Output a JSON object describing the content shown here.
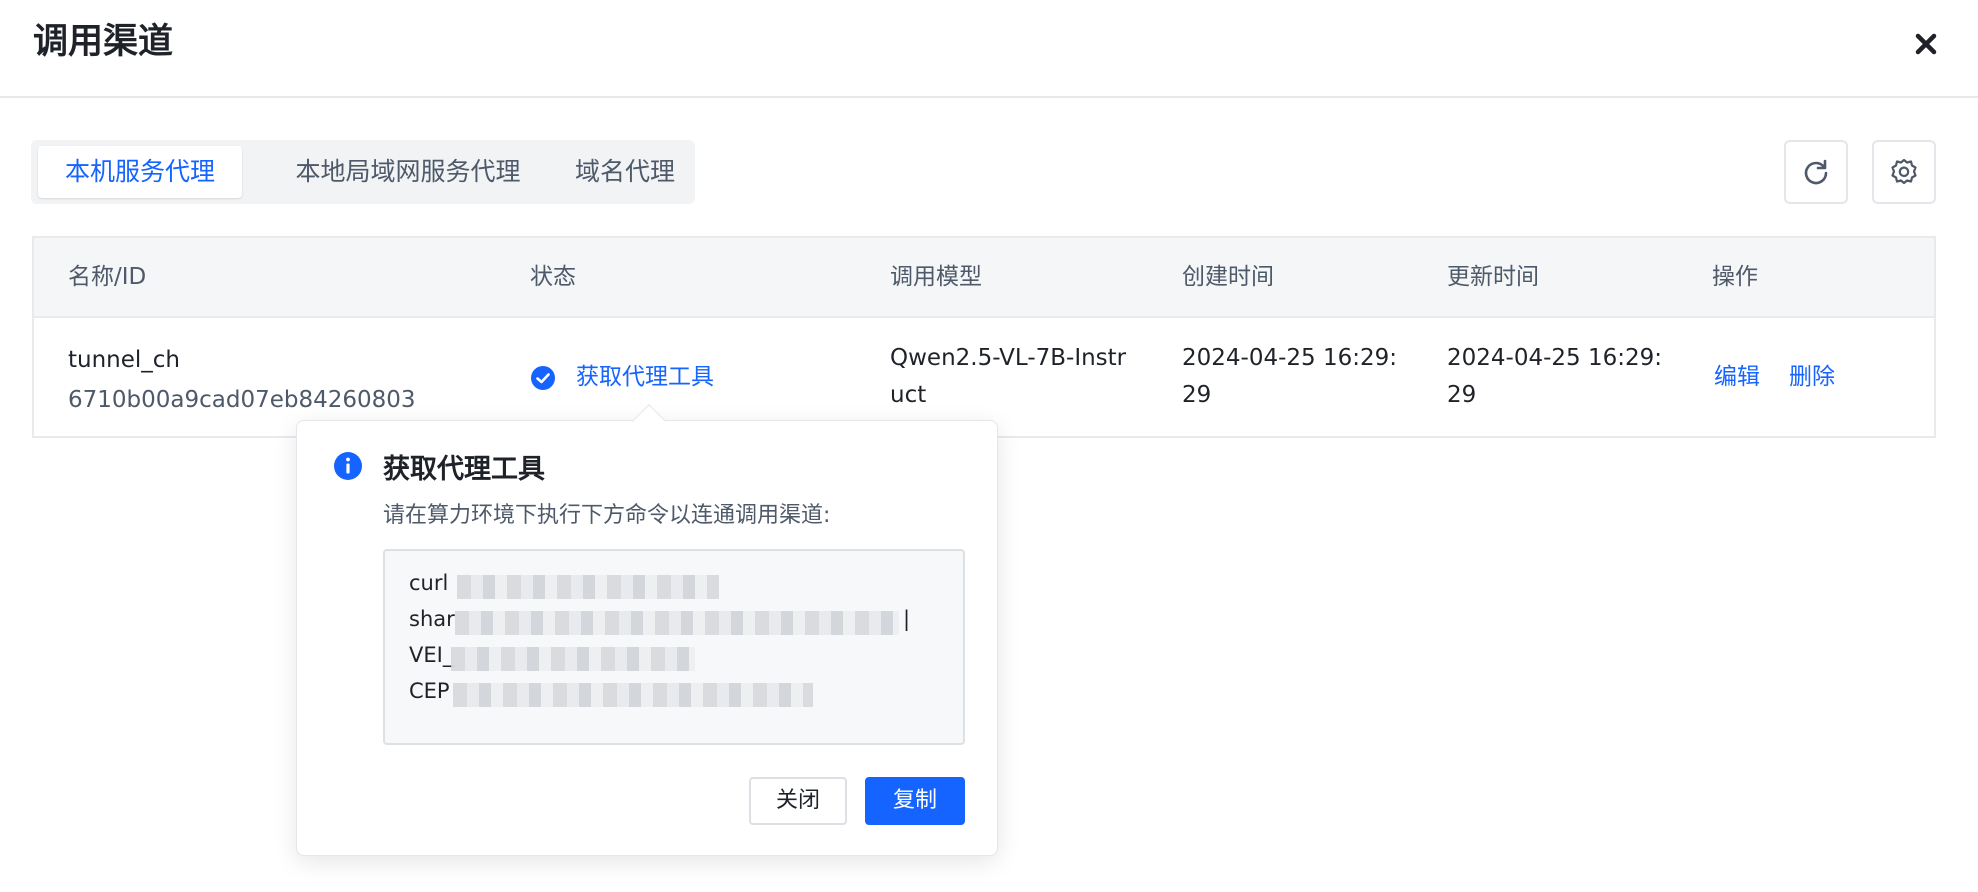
{
  "dialog": {
    "title": "调用渠道"
  },
  "tabs": [
    {
      "label": "本机服务代理",
      "active": true
    },
    {
      "label": "本地局域网服务代理",
      "active": false
    },
    {
      "label": "域名代理",
      "active": false
    }
  ],
  "toolbar": {
    "refresh_icon": "refresh-icon",
    "settings_icon": "gear-icon"
  },
  "table": {
    "headers": [
      "名称/ID",
      "状态",
      "调用模型",
      "创建时间",
      "更新时间",
      "操作"
    ],
    "rows": [
      {
        "name": "tunnel_ch",
        "id": "6710b00a9cad07eb84260803",
        "status": "获取代理工具",
        "model_line1": "Qwen2.5-VL-7B-Instr",
        "model_line2": "uct",
        "created_line1": "2024-04-25 16:29:",
        "created_line2": "29",
        "updated_line1": "2024-04-25 16:29:",
        "updated_line2": "29",
        "actions": {
          "edit": "编辑",
          "delete": "删除"
        }
      }
    ]
  },
  "popover": {
    "title": "获取代理工具",
    "description": "请在算力环境下执行下方命令以连通调用渠道:",
    "command_lines": [
      "curl",
      "shar",
      "VEI_",
      "CEP"
    ],
    "command_tail": "|",
    "close_label": "关闭",
    "copy_label": "复制"
  },
  "colors": {
    "accent": "#1664ff",
    "header_bg": "#f5f6f8"
  }
}
